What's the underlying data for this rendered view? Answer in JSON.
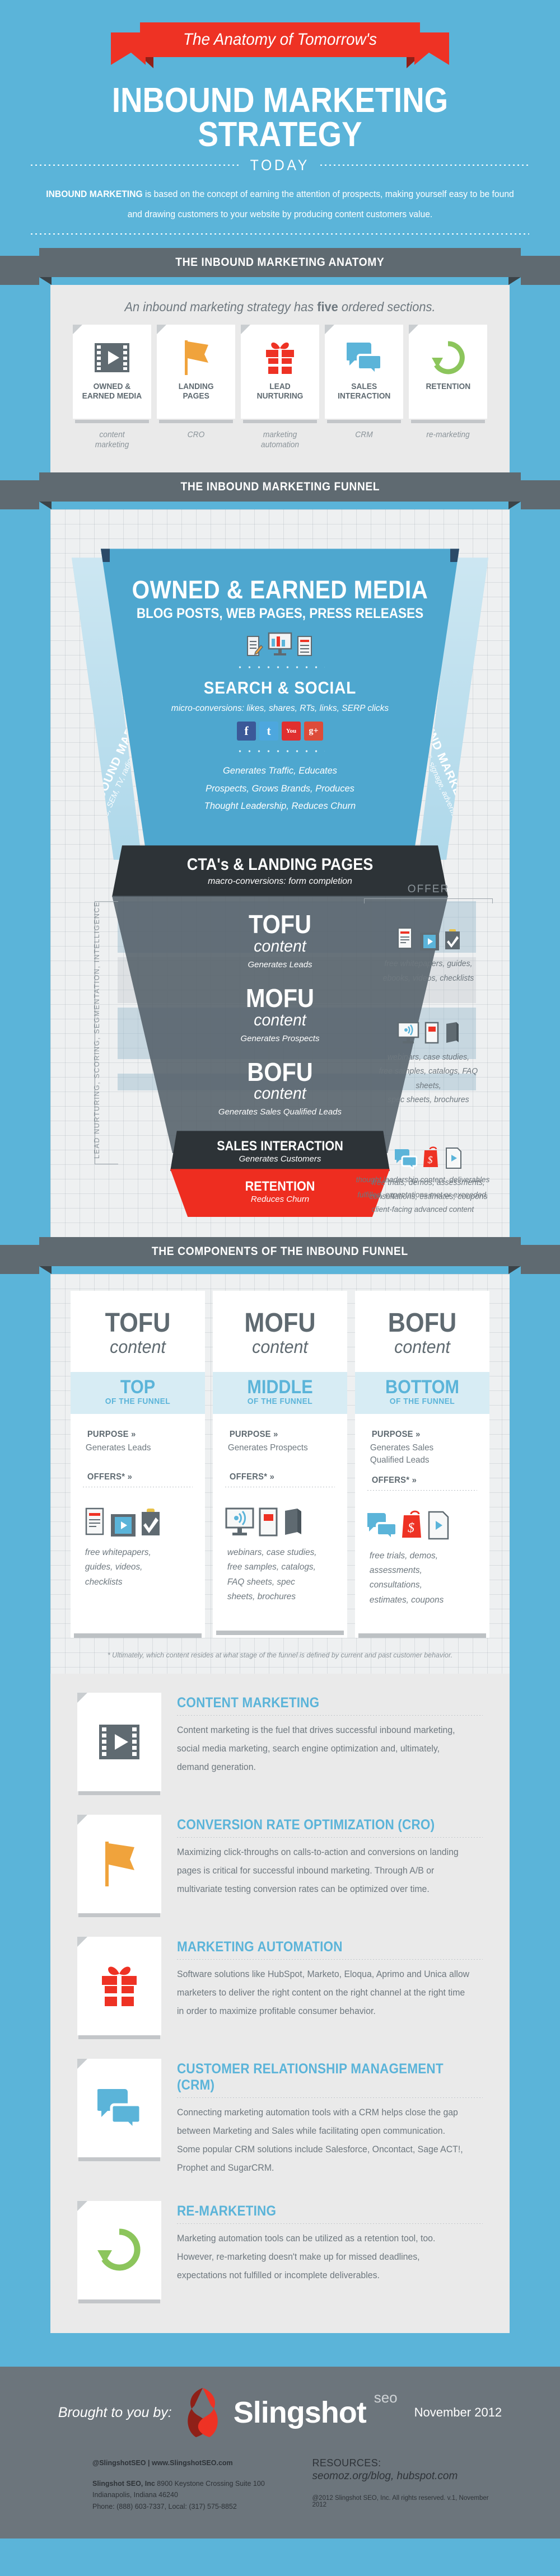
{
  "colors": {
    "sky": "#5bb4d9",
    "slate": "#5f6a71",
    "red": "#ee3224",
    "dark": "#2d3337",
    "paper": "#eaeaea",
    "lightblue": "#d7ecf4",
    "green": "#8cc55c",
    "orange": "#f0a33c"
  },
  "header": {
    "ribbon": "The Anatomy of Tomorrow's",
    "title": "INBOUND MARKETING STRATEGY",
    "today": "TODAY",
    "lead_bold": "INBOUND MARKETING",
    "lead_rest": " is based on the concept of earning the attention of prospects, making yourself easy to be found and drawing customers to your website by producing content customers value."
  },
  "anatomy": {
    "banner": "THE INBOUND MARKETING ANATOMY",
    "subtitle_a": "An inbound marketing strategy has ",
    "subtitle_b": "five",
    "subtitle_c": " ordered sections.",
    "cards": [
      {
        "icon": "film-play-icon",
        "name": "OWNED &\nEARNED MEDIA",
        "sub": "content\nmarketing"
      },
      {
        "icon": "flag-icon",
        "name": "LANDING\nPAGES",
        "sub": "CRO"
      },
      {
        "icon": "gift-icon",
        "name": "LEAD\nNURTURING",
        "sub": "marketing\nautomation"
      },
      {
        "icon": "speech-bubbles-icon",
        "name": "SALES\nINTERACTION",
        "sub": "CRM"
      },
      {
        "icon": "refresh-arrow-icon",
        "name": "RETENTION",
        "sub": "re-marketing"
      }
    ]
  },
  "funnel": {
    "banner": "THE INBOUND MARKETING FUNNEL",
    "outbound_left_big": "OUTBOUND MARKETING",
    "outbound_left_small": "PPC, SEM, TV, radio, call center",
    "outbound_right_big": "OUTBOUND MARKETING",
    "outbound_right_small": "direct mail, signage, advertising",
    "top_title": "OWNED & EARNED MEDIA",
    "top_sub": "BLOG POSTS, WEB PAGES, PRESS RELEASES",
    "search_social": "SEARCH & SOCIAL",
    "micro": "micro-conversions: likes, shares, RTs, links, SERP clicks",
    "social_icons": [
      "facebook-icon",
      "twitter-icon",
      "youtube-icon",
      "google-plus-icon"
    ],
    "outcome_lines": [
      "Generates Traffic, Educates",
      "Prospects, Grows Brands, Produces",
      "Thought Leadership, Reduces Churn"
    ],
    "cta_title": "CTA's & LANDING PAGES",
    "cta_sub": "macro-conversions: form completion",
    "stages": [
      {
        "big": "TOFU",
        "small": "content",
        "gen": "Generates Leads"
      },
      {
        "big": "MOFU",
        "small": "content",
        "gen": "Generates Prospects"
      },
      {
        "big": "BOFU",
        "small": "content",
        "gen": "Generates Sales Qualified Leads"
      }
    ],
    "sales_title": "SALES INTERACTION",
    "sales_sub": "Generates Customers",
    "retention_title": "RETENTION",
    "retention_sub": "Reduces Churn",
    "left_axis": "LEAD NURTURING, SCORING, SEGMENTATION, INTELLIGENCE",
    "offer_label": "OFFER",
    "offers": [
      {
        "caption": "free whitepapers, guides,\nebooks, videos, checklists"
      },
      {
        "caption": "webinars, case studies,\nfree samples, catalogs, FAQ sheets,\nspec sheets, brochures"
      },
      {
        "caption": "free trials, demos, assessments,\nconsultations, estimates, coupons"
      }
    ],
    "retention_note": "thought leadership content, deliverables\nfulfilled, expectations met or exceeded,\nclient-facing advanced content"
  },
  "components": {
    "banner": "THE COMPONENTS OF THE INBOUND FUNNEL",
    "purpose_label": "PURPOSE »",
    "offers_label": "OFFERS* »",
    "columns": [
      {
        "big": "TOFU",
        "small": "content",
        "pos1": "TOP",
        "pos2": "OF THE FUNNEL",
        "purpose": "Generates Leads",
        "offers": "free whitepapers,\nguides, videos,\nchecklists"
      },
      {
        "big": "MOFU",
        "small": "content",
        "pos1": "MIDDLE",
        "pos2": "OF THE FUNNEL",
        "purpose": "Generates Prospects",
        "offers": "webinars, case studies,\nfree samples, catalogs,\nFAQ sheets, spec\nsheets, brochures"
      },
      {
        "big": "BOFU",
        "small": "content",
        "pos1": "BOTTOM",
        "pos2": "OF THE FUNNEL",
        "purpose": "Generates Sales\nQualified Leads",
        "offers": "free trials, demos,\nassessments,\nconsultations,\nestimates, coupons"
      }
    ],
    "note": "* Ultimately, which content resides at what stage of the funnel is defined by current and past customer behavior."
  },
  "descriptions": [
    {
      "icon": "film-play-icon",
      "title": "CONTENT MARKETING",
      "body": "Content marketing is the fuel that drives successful inbound marketing, social media marketing, search engine optimization and, ultimately, demand generation."
    },
    {
      "icon": "flag-icon",
      "title": "CONVERSION RATE OPTIMIZATION (CRO)",
      "body": "Maximizing click-throughs on calls-to-action and conversions on landing pages is critical for successful inbound marketing. Through A/B or multivariate testing conversion rates can be optimized over time."
    },
    {
      "icon": "gift-icon",
      "title": "MARKETING AUTOMATION",
      "body": "Software solutions like HubSpot, Marketo, Eloqua, Aprimo and Unica allow marketers to deliver the right content on the right channel at the right time in order to maximize profitable consumer behavior."
    },
    {
      "icon": "speech-bubbles-icon",
      "title": "CUSTOMER RELATIONSHIP MANAGEMENT (CRM)",
      "body": "Connecting marketing automation tools with a CRM helps close the gap between Marketing and Sales while facilitating open communication. Some popular CRM solutions include Salesforce, Oncontact, Sage ACT!, Prophet and SugarCRM."
    },
    {
      "icon": "refresh-arrow-icon",
      "title": "RE-MARKETING",
      "body": "Marketing automation tools can be utilized as a retention tool, too. However, re-marketing doesn't make up for missed deadlines, expectations not fulfilled or incomplete deliverables."
    }
  ],
  "footer": {
    "brought_by": "Brought to you by:",
    "brand": "Slingshot",
    "brand_sup": "seo",
    "date": "November 2012",
    "social_line": "@SlingshotSEO  |  www.SlingshotSEO.com",
    "addr_bold": "Slingshot SEO, Inc",
    "addr_rest": " 8900 Keystone Crossing Suite 100",
    "addr_line2": "Indianapolis, Indiana 46240",
    "addr_line3": "Phone: (888) 603-7337, Local: (317) 575-8852",
    "resources_label": "RESOURCES:",
    "resources": "seomoz.org/blog, hubspot.com",
    "copyright": "@2012 Slingshot SEO, Inc. All rights reserved. v.1, November 2012"
  }
}
